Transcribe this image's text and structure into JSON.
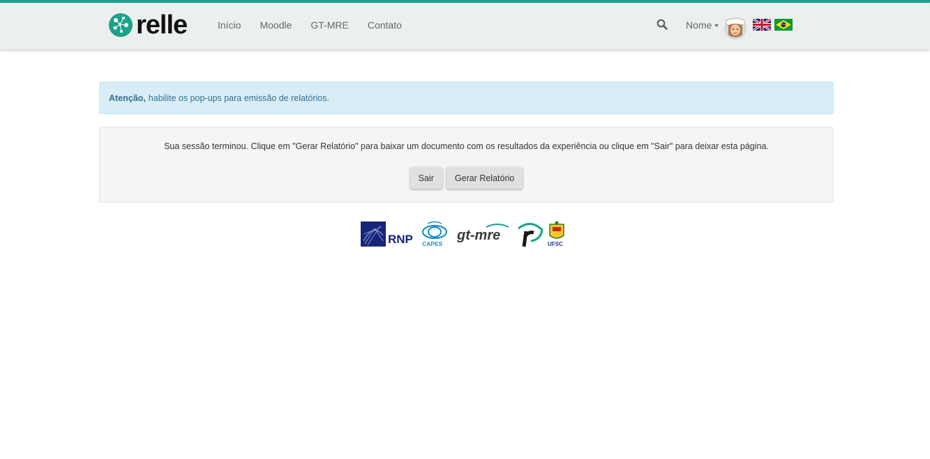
{
  "header": {
    "logo_text": "relle",
    "nav": [
      "Início",
      "Moodle",
      "GT-MRE",
      "Contato"
    ],
    "user_name": "Nome",
    "accent_color": "#1aa38a"
  },
  "alert": {
    "strong": "Atenção,",
    "text": "habilite os pop-ups para emissão de relatórios."
  },
  "session": {
    "message": "Sua sessão terminou. Clique em \"Gerar Relatório\" para baixar um documento com os resultados da experiência ou clique em \"Sair\" para deixar esta página.",
    "exit_label": "Sair",
    "report_label": "Gerar Relatório"
  },
  "footer_logos": {
    "rnp": "RNP",
    "capes": "CAPES",
    "gtmre": "gt-mre",
    "ufsc": "UFSC"
  }
}
